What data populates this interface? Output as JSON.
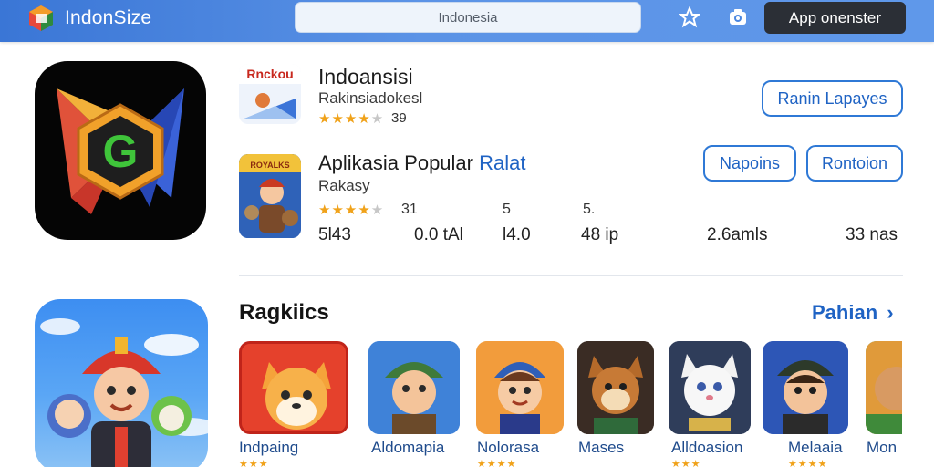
{
  "header": {
    "brand": "IndonSize",
    "search_placeholder": "Indonesia",
    "app_button": "App onenster",
    "icons": [
      "logo-icon",
      "star-badge-icon",
      "camera-icon"
    ]
  },
  "featured": {
    "title": "Indoansisi",
    "subtitle": "Rakinsiadokesl",
    "rating_count": "39",
    "stars": 4,
    "button": "Ranin Lapayes"
  },
  "popular": {
    "title": "Aplikasia Popular",
    "title_accent": "Ralat",
    "subtitle": "Rakasy",
    "stars": 4,
    "rating_count": "31",
    "buttons": [
      "Napoins",
      "Rontoion"
    ],
    "stat_labels": [
      "5",
      "5."
    ],
    "stats": [
      "5l43",
      "0.0 tAl",
      "l4.0",
      "48 ip",
      "2.6amls",
      "33 nas"
    ]
  },
  "section": {
    "title": "Ragkiics",
    "see_all": "Pahian"
  },
  "cards": [
    {
      "label": "Indpaing"
    },
    {
      "label": "Aldomapia"
    },
    {
      "label": "Nolorasa"
    },
    {
      "label": "Mases"
    },
    {
      "label": "Alldoasion"
    },
    {
      "label": "Melaaia"
    },
    {
      "label": "Mon"
    }
  ],
  "colors": {
    "header": "#4a86e0",
    "accent": "#1f63c4",
    "star": "#f0a21a"
  }
}
